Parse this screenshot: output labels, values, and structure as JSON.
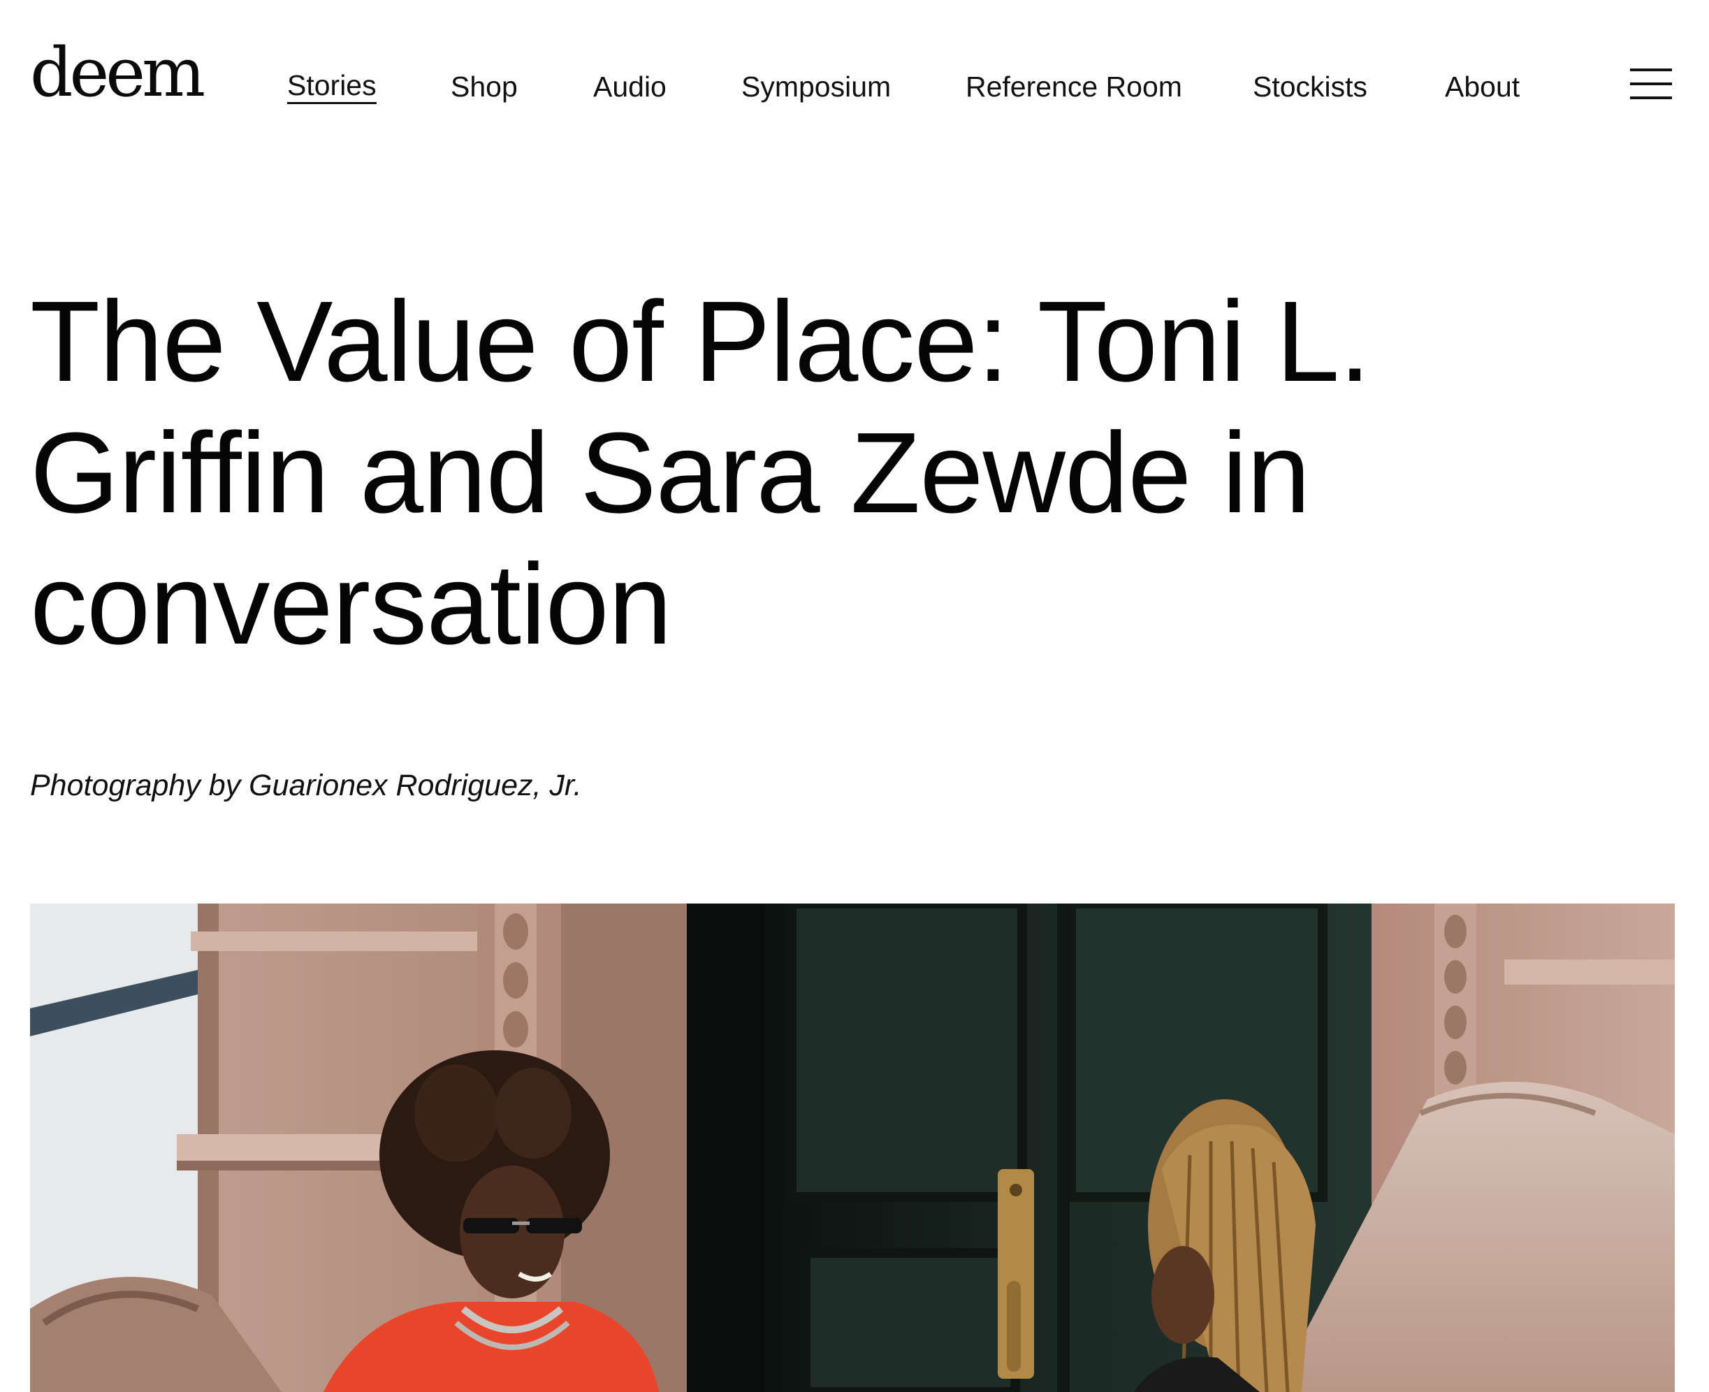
{
  "header": {
    "logo": "deem",
    "nav": [
      {
        "label": "Stories",
        "active": true
      },
      {
        "label": "Shop",
        "active": false
      },
      {
        "label": "Audio",
        "active": false
      },
      {
        "label": "Symposium",
        "active": false
      },
      {
        "label": "Reference Room",
        "active": false
      },
      {
        "label": "Stockists",
        "active": false
      },
      {
        "label": "About",
        "active": false
      }
    ],
    "menu_icon": "hamburger-menu-icon"
  },
  "article": {
    "title": "The Value of Place: Toni L. Griffin and Sara Zewde in conversation",
    "credit": "Photography by Guarionex Rodriguez, Jr.",
    "hero_image": {
      "subject": "two women talking on the brownstone stoop steps in front of a dark green double door"
    }
  },
  "colors": {
    "text": "#0a0a0a",
    "background": "#ffffff",
    "brownstone": "#b89383",
    "door": "#1c2a26",
    "coat": "#e8452b",
    "brass": "#b28a45"
  }
}
